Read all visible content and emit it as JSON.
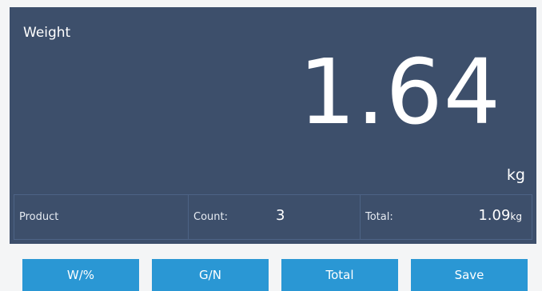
{
  "display": {
    "weight_label": "Weight",
    "weight_value": "1.64",
    "weight_unit": "kg"
  },
  "info": {
    "product_label": "Product",
    "count_label": "Count:",
    "count_value": "3",
    "total_label": "Total:",
    "total_value": "1.09",
    "total_unit": "kg"
  },
  "buttons": {
    "wp_label": "W/%",
    "gn_label": "G/N",
    "total_label": "Total",
    "save_label": "Save"
  },
  "colors": {
    "panel_background": "#3d4f6b",
    "button": "#2a97d4"
  }
}
